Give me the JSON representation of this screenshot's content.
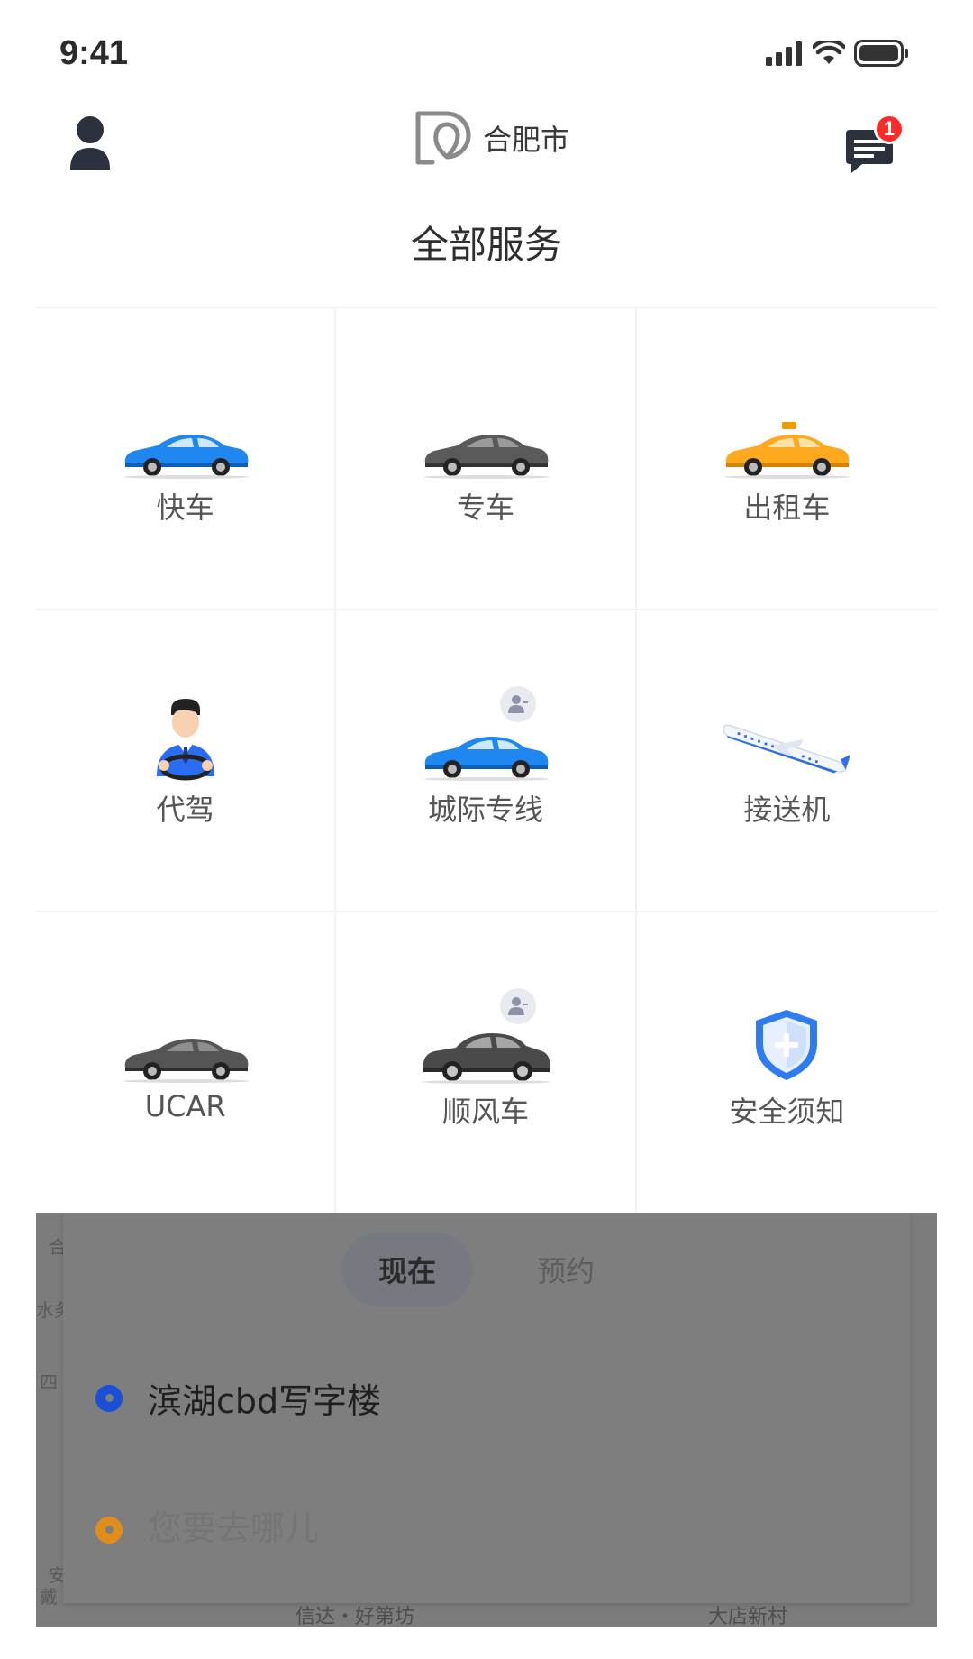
{
  "status_bar": {
    "time": "9:41"
  },
  "header": {
    "city": "合肥市",
    "message_badge_count": "1"
  },
  "section_title": "全部服务",
  "services": [
    {
      "label": "快车",
      "icon": "car-blue-icon",
      "color": "#1e88f0"
    },
    {
      "label": "专车",
      "icon": "car-gray-icon",
      "color": "#5a5a5a"
    },
    {
      "label": "出租车",
      "icon": "taxi-icon",
      "color": "#ffa91e"
    },
    {
      "label": "代驾",
      "icon": "driver-icon",
      "color": "#2a6df0"
    },
    {
      "label": "城际专线",
      "icon": "car-blue-icon",
      "color": "#1e88f0"
    },
    {
      "label": "接送机",
      "icon": "airplane-icon",
      "color": "#e9eef6"
    },
    {
      "label": "UCAR",
      "icon": "car-gray-icon",
      "color": "#555555"
    },
    {
      "label": "顺风车",
      "icon": "suv-icon",
      "color": "#4a4a4a"
    },
    {
      "label": "安全须知",
      "icon": "shield-icon",
      "color": "#2f7cf0"
    }
  ],
  "booking": {
    "tabs": [
      "现在",
      "预约"
    ],
    "start_location": "滨湖cbd写字楼",
    "destination_placeholder": "您要去哪儿",
    "start_dot_color": "#1b4fd6",
    "dest_dot_color": "#e08e1b"
  },
  "map": {
    "labels": [
      "合",
      "水务",
      "四",
      "安",
      "戴",
      "信达・好第坊",
      "大店新村"
    ]
  }
}
